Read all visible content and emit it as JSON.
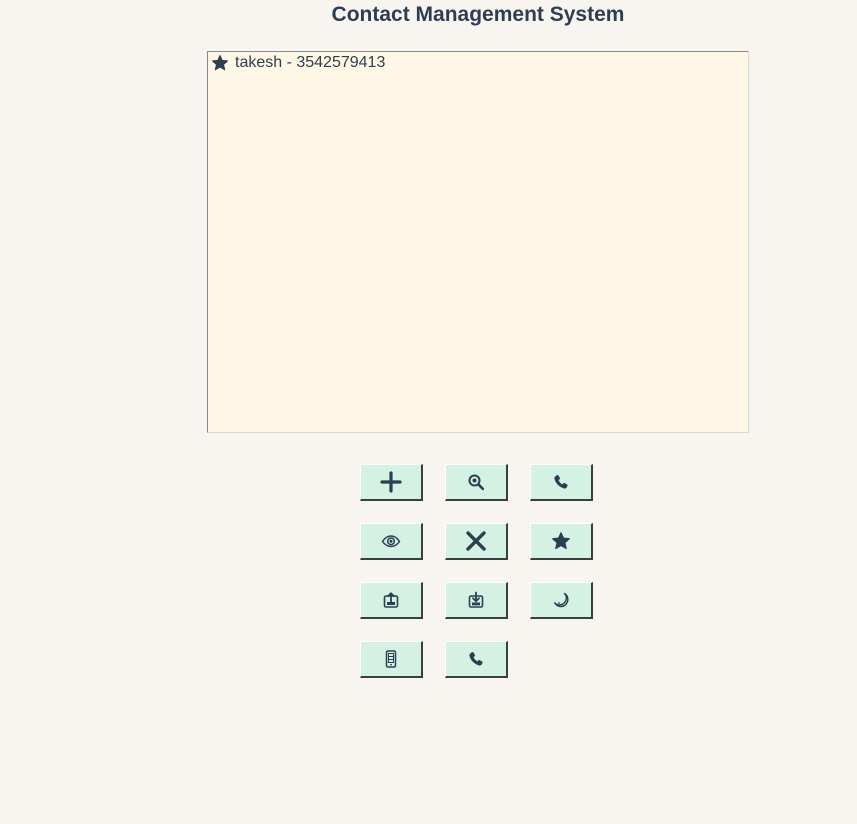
{
  "window": {
    "title": "Contact Management System"
  },
  "contacts": [
    {
      "text": "takesh - 3542579413",
      "favorite_icon": "star-icon"
    }
  ],
  "toolbar": {
    "buttons": [
      {
        "name": "add-contact-button",
        "icon": "plus-icon"
      },
      {
        "name": "search-contact-button",
        "icon": "magnifier-icon"
      },
      {
        "name": "call-contact-button",
        "icon": "phone-icon"
      },
      {
        "name": "view-contact-button",
        "icon": "eye-icon"
      },
      {
        "name": "delete-contact-button",
        "icon": "x-icon"
      },
      {
        "name": "favorite-contact-button",
        "icon": "star-icon"
      },
      {
        "name": "export-contacts-button",
        "icon": "export-icon"
      },
      {
        "name": "import-contacts-button",
        "icon": "import-icon"
      },
      {
        "name": "dark-mode-button",
        "icon": "moon-icon"
      },
      {
        "name": "mobile-view-button",
        "icon": "mobile-icon"
      },
      {
        "name": "dial-button",
        "icon": "phone-icon"
      }
    ]
  },
  "colors": {
    "background": "#f8f5f1",
    "list_background": "#fff7e6",
    "button_background": "#d4f2e4",
    "icon_color": "#2c3e50"
  }
}
